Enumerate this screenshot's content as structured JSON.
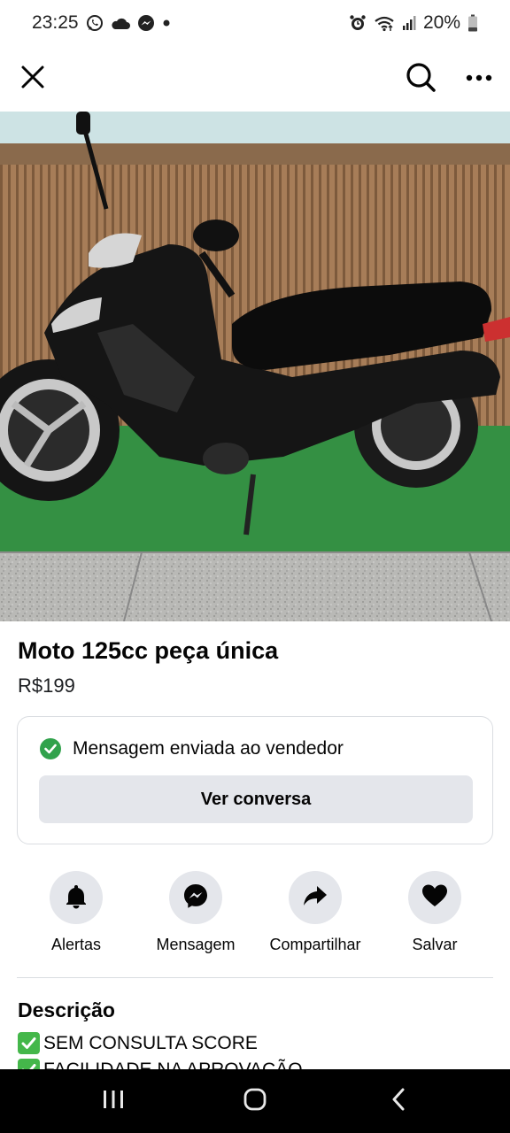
{
  "status_bar": {
    "time": "23:25",
    "battery": "20%",
    "left_icons": [
      "whatsapp-icon",
      "cloud-icon",
      "messenger-icon",
      "dot-icon"
    ],
    "right_icons": [
      "alarm-icon",
      "wifi-icon",
      "signal-icon",
      "battery-icon"
    ]
  },
  "top_bar": {
    "icons": [
      "close-icon",
      "search-icon",
      "more-icon"
    ]
  },
  "photo": {
    "subject": "black motorcycle on green artificial grass",
    "pager_count": 5,
    "pager_active": 1
  },
  "listing": {
    "title": "Moto 125cc peça única",
    "price": "R$199"
  },
  "message_card": {
    "status": "Mensagem enviada ao vendedor",
    "button": "Ver conversa",
    "status_color": "#31a24c"
  },
  "actions": [
    {
      "label": "Alertas",
      "icon": "bell-icon"
    },
    {
      "label": "Mensagem",
      "icon": "messenger-icon"
    },
    {
      "label": "Compartilhar",
      "icon": "share-icon"
    },
    {
      "label": "Salvar",
      "icon": "heart-icon"
    }
  ],
  "description": {
    "heading": "Descrição",
    "lines": [
      "SEM CONSULTA SCORE",
      "FACILIDADE NA APROVAÇÃO"
    ]
  },
  "nav_bar": {
    "icons": [
      "recent-apps-icon",
      "home-icon",
      "back-icon"
    ]
  }
}
